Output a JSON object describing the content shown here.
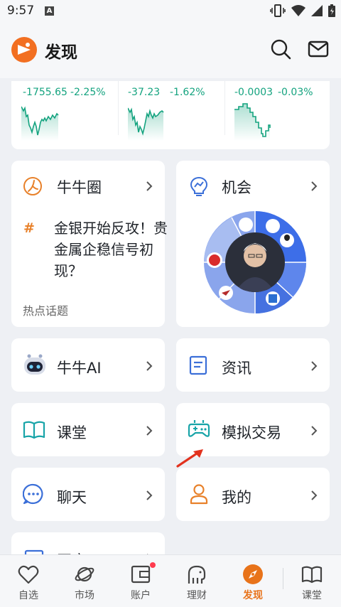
{
  "status_bar": {
    "time": "9:57",
    "notification_letter": "A"
  },
  "header": {
    "title": "发现"
  },
  "market": [
    {
      "change": "-1755.65",
      "percent": "-2.25%"
    },
    {
      "change": "-37.23",
      "percent": "-1.62%"
    },
    {
      "change": "-0.0003",
      "percent": "-0.03%"
    }
  ],
  "cards": {
    "circle": {
      "title": "牛牛圈",
      "topic": "金银开始反攻！贵金属企稳信号初现？",
      "topic_label": "热点话题"
    },
    "opportunity": {
      "title": "机会"
    },
    "ai": {
      "title": "牛牛AI"
    },
    "news": {
      "title": "资讯"
    },
    "classroom": {
      "title": "课堂"
    },
    "sim_trade": {
      "title": "模拟交易"
    },
    "chat": {
      "title": "聊天"
    },
    "mine": {
      "title": "我的"
    },
    "partial": {
      "title": "开户"
    }
  },
  "bottom_nav": [
    {
      "label": "自选",
      "icon": "heart-icon"
    },
    {
      "label": "市场",
      "icon": "planet-icon"
    },
    {
      "label": "账户",
      "icon": "wallet-icon"
    },
    {
      "label": "理财",
      "icon": "elephant-icon"
    },
    {
      "label": "发现",
      "icon": "compass-icon",
      "active": true
    },
    {
      "label": "课堂",
      "icon": "book-icon"
    }
  ],
  "colors": {
    "accent": "#e8731a",
    "up_green": "#14a37f",
    "blue": "#3b6fd8"
  }
}
